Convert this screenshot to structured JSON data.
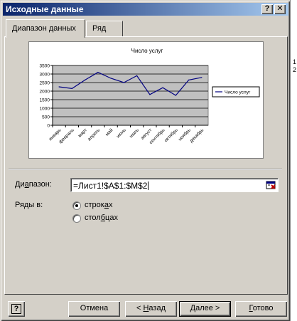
{
  "window": {
    "title": "Исходные данные",
    "help_glyph": "?",
    "close_glyph": "✕"
  },
  "tabs": [
    {
      "label": "Диапазон данных",
      "active": true
    },
    {
      "label": "Ряд",
      "active": false
    }
  ],
  "chart_data": {
    "type": "line",
    "title": "Число услуг",
    "categories": [
      "январь",
      "февраль",
      "март",
      "апрель",
      "май",
      "июнь",
      "июль",
      "август",
      "сентябрь",
      "октябрь",
      "ноябрь",
      "декабрь"
    ],
    "series": [
      {
        "name": "Число услуг",
        "values": [
          2250,
          2150,
          2650,
          3100,
          2750,
          2500,
          2900,
          1800,
          2200,
          1750,
          2650,
          2800
        ]
      }
    ],
    "y_ticks": [
      "0",
      "500",
      "1000",
      "1500",
      "2000",
      "2500",
      "3000",
      "3500"
    ],
    "ylim": [
      0,
      3500
    ],
    "plot_bg": "#c0c0c0",
    "line_color": "#000080",
    "grid": true,
    "legend_position": "right"
  },
  "range": {
    "label_pre": "Ди",
    "label_hot": "а",
    "label_post": "пазон:",
    "value": "=Лист1!$A$1:$M$2",
    "collapse_icon": "range-collapse-icon"
  },
  "series_in": {
    "label": "Ряды в:",
    "options": [
      {
        "pre": "строк",
        "hot": "а",
        "post": "х",
        "selected": true
      },
      {
        "pre": "стол",
        "hot": "б",
        "post": "цах",
        "selected": false
      }
    ]
  },
  "buttons": {
    "help_glyph": "?",
    "cancel": "Отмена",
    "back_pre": "< ",
    "back_hot": "Н",
    "back_post": "азад",
    "next_hot": "Д",
    "next_post": "алее >",
    "finish_hot": "Г",
    "finish_post": "отово"
  }
}
